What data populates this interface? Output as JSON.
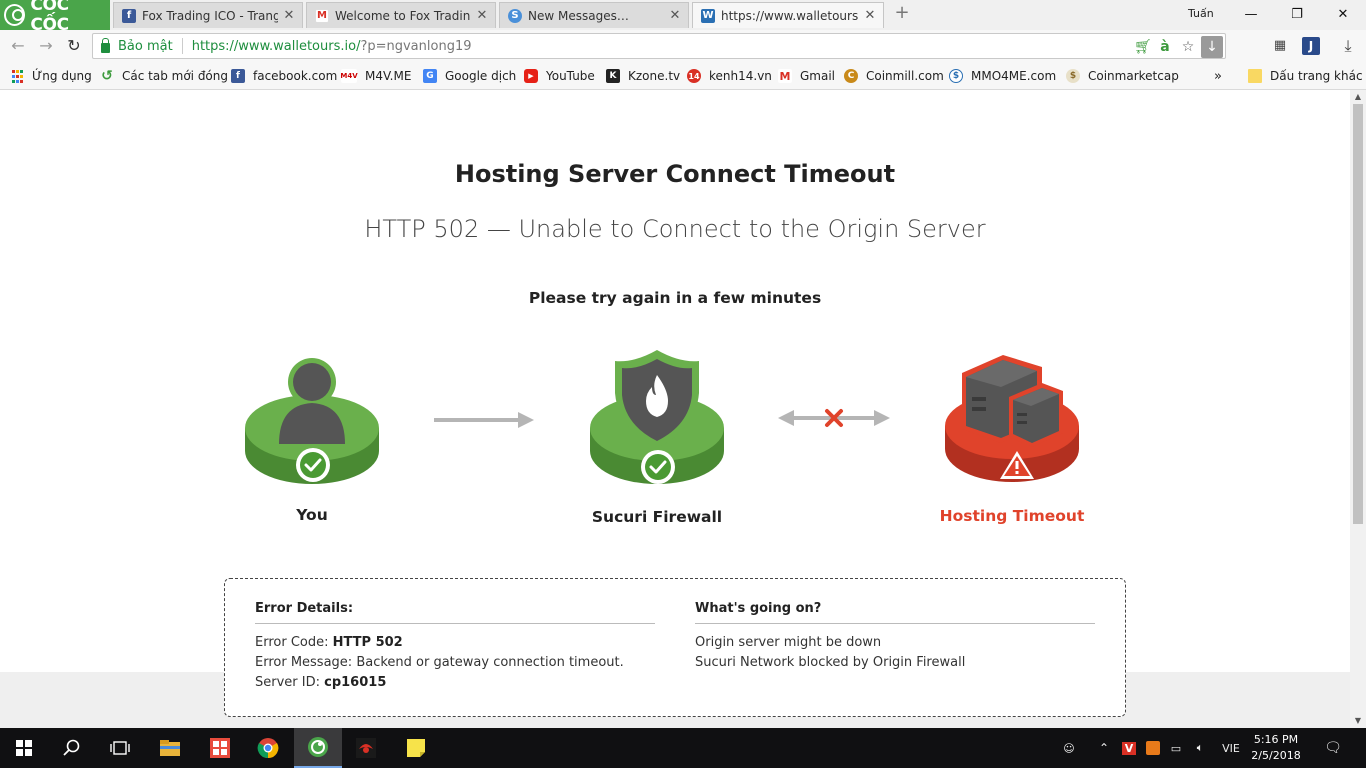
{
  "browser": {
    "brand": "CỐC CỐC",
    "tabs": [
      {
        "title": "Fox Trading ICO - Trang ch",
        "icon": "facebook-icon",
        "color": "#3b5998"
      },
      {
        "title": "Welcome to Fox Trading IC",
        "icon": "gmail-icon",
        "color": "#d93025"
      },
      {
        "title": "New Messages…",
        "icon": "steemit-icon",
        "color": "#4a90d9"
      },
      {
        "title": "https://www.walletours.io/",
        "icon": "walletours-icon",
        "color": "#2a6fb3"
      }
    ],
    "profile_name": "Tuấn",
    "secure_label": "Bảo mật",
    "url_main": "https://www.walletours.io/",
    "url_rest": "?p=ngvanlong19",
    "bookmarks": [
      {
        "label": "Ứng dụng",
        "icon": "apps-grid-icon"
      },
      {
        "label": "Các tab mới đóng",
        "icon": "history-icon"
      },
      {
        "label": "facebook.com",
        "icon": "facebook-icon"
      },
      {
        "label": "M4V.ME",
        "icon": "m4v-icon"
      },
      {
        "label": "Google dịch",
        "icon": "google-translate-icon"
      },
      {
        "label": "YouTube",
        "icon": "youtube-icon"
      },
      {
        "label": "Kzone.tv",
        "icon": "kzone-icon"
      },
      {
        "label": "kenh14.vn",
        "icon": "kenh14-icon"
      },
      {
        "label": "Gmail",
        "icon": "gmail-icon"
      },
      {
        "label": "Coinmill.com",
        "icon": "coinmill-icon"
      },
      {
        "label": "MMO4ME.com",
        "icon": "mmo4me-icon"
      },
      {
        "label": "Coinmarketcap",
        "icon": "coinmarketcap-icon"
      }
    ],
    "other_bookmarks": "Dấu trang khác"
  },
  "page": {
    "title": "Hosting Server Connect Timeout",
    "subtitle": "HTTP 502 — Unable to Connect to the Origin Server",
    "retry": "Please try again in a few minutes",
    "nodes": {
      "you": "You",
      "firewall": "Sucuri Firewall",
      "hosting": "Hosting Timeout"
    },
    "details": {
      "left_heading": "Error Details:",
      "code_label": "Error Code: ",
      "code_value": "HTTP 502",
      "message_label": "Error Message: ",
      "message_value": "Backend or gateway connection timeout.",
      "server_label": "Server ID: ",
      "server_value": "cp16015",
      "right_heading": "What's going on?",
      "reason_1": "Origin server might be down",
      "reason_2": "Sucuri Network blocked by Origin Firewall"
    }
  },
  "colors": {
    "green": "#6ab04c",
    "green_dark": "#4a8a33",
    "red": "#e0432b",
    "red_dark": "#b23020",
    "icon_gray": "#555555"
  },
  "taskbar": {
    "language": "VIE",
    "time": "5:16 PM",
    "date": "2/5/2018"
  }
}
